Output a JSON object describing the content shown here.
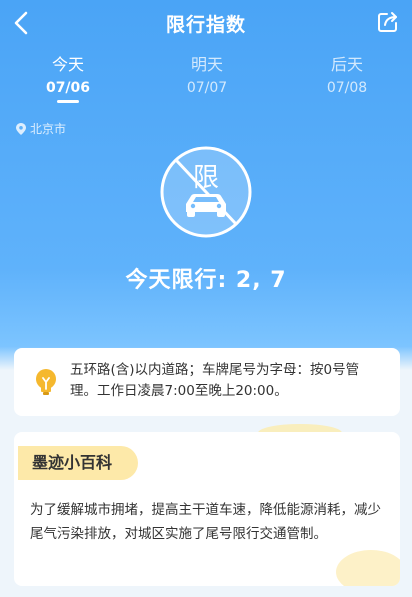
{
  "header": {
    "title": "限行指数"
  },
  "tabs": [
    {
      "label": "今天",
      "date": "07/06"
    },
    {
      "label": "明天",
      "date": "07/07"
    },
    {
      "label": "后天",
      "date": "07/08"
    }
  ],
  "location": "北京市",
  "badge_char": "限",
  "restriction_text": "今天限行: 2, 7",
  "info": {
    "text": "五环路(含)以内道路；车牌尾号为字母：按0号管理。工作日凌晨7:00至晚上20:00。"
  },
  "wiki": {
    "tag": "墨迹小百科",
    "text": "为了缓解城市拥堵，提高主干道车速，降低能源消耗，减少尾气污染排放，对城区实施了尾号限行交通管制。"
  },
  "colors": {
    "primary": "#4aa4f6",
    "tag_bg": "#fde9a9",
    "bulb": "#f5b82e"
  }
}
